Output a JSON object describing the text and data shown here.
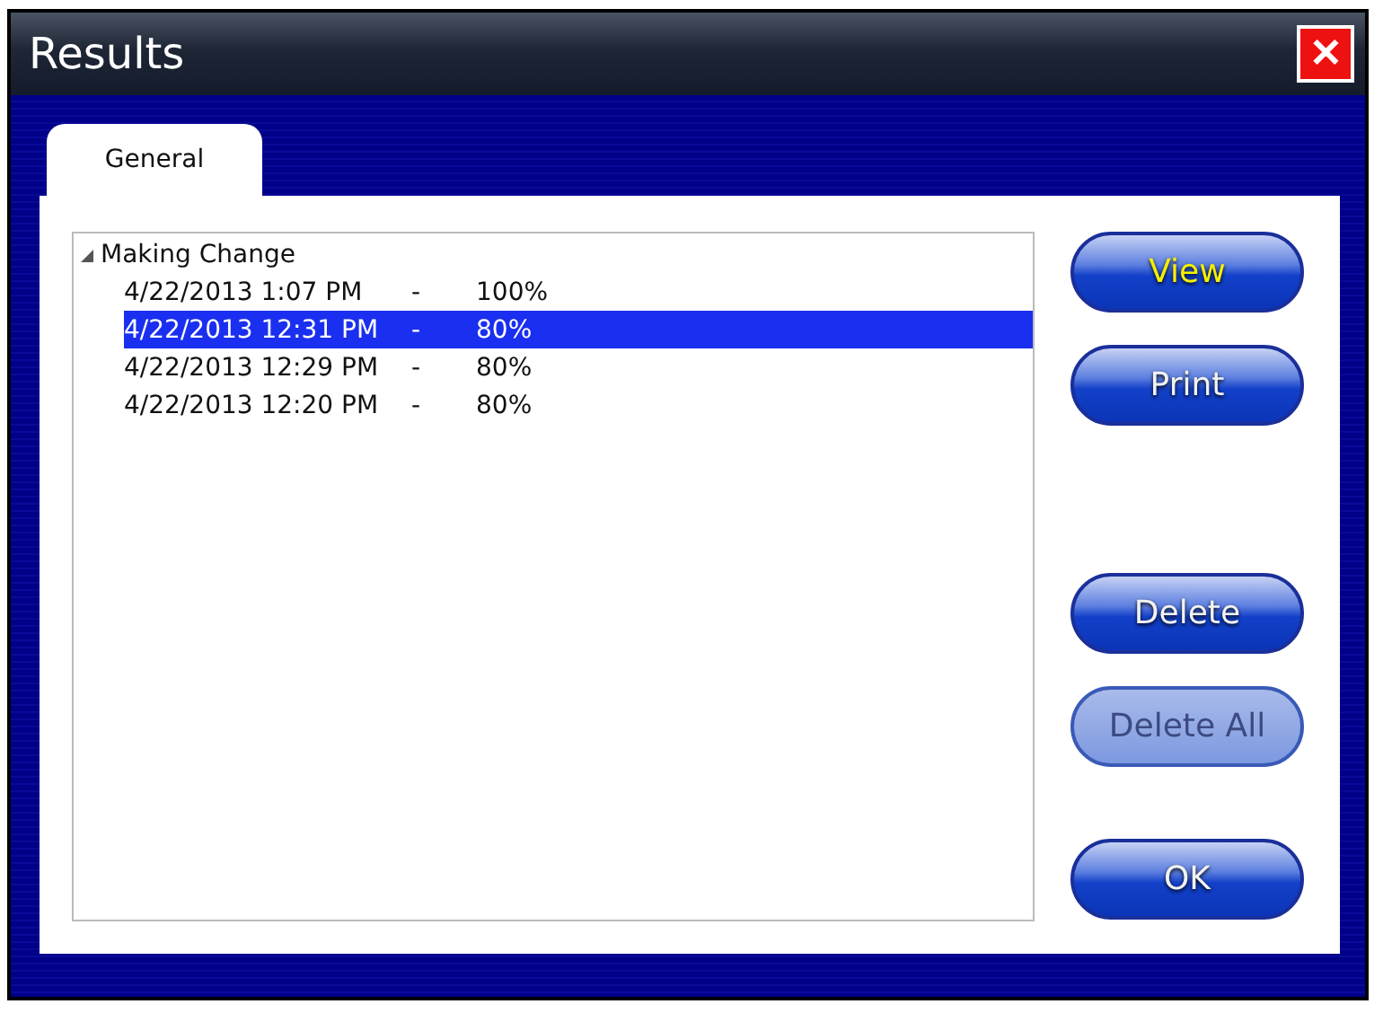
{
  "window": {
    "title": "Results",
    "close": "✕"
  },
  "tabs": [
    {
      "label": "General",
      "selected": true
    }
  ],
  "tree": {
    "label": "Making Change",
    "expanded": true,
    "children": [
      {
        "date": "4/22/2013 1:07 PM",
        "separator": "-",
        "score": "100%",
        "selected": false
      },
      {
        "date": "4/22/2013 12:31 PM",
        "separator": "-",
        "score": "80%",
        "selected": true
      },
      {
        "date": "4/22/2013 12:29 PM",
        "separator": "-",
        "score": "80%",
        "selected": false
      },
      {
        "date": "4/22/2013 12:20 PM",
        "separator": "-",
        "score": "80%",
        "selected": false
      }
    ]
  },
  "buttons": [
    {
      "label": "View",
      "focused": true,
      "disabled": false
    },
    {
      "label": "Print",
      "focused": false,
      "disabled": false
    },
    {
      "label": "Delete",
      "focused": false,
      "disabled": false
    },
    {
      "label": "Delete All",
      "focused": false,
      "disabled": true
    },
    {
      "label": "OK",
      "focused": false,
      "disabled": false
    }
  ]
}
